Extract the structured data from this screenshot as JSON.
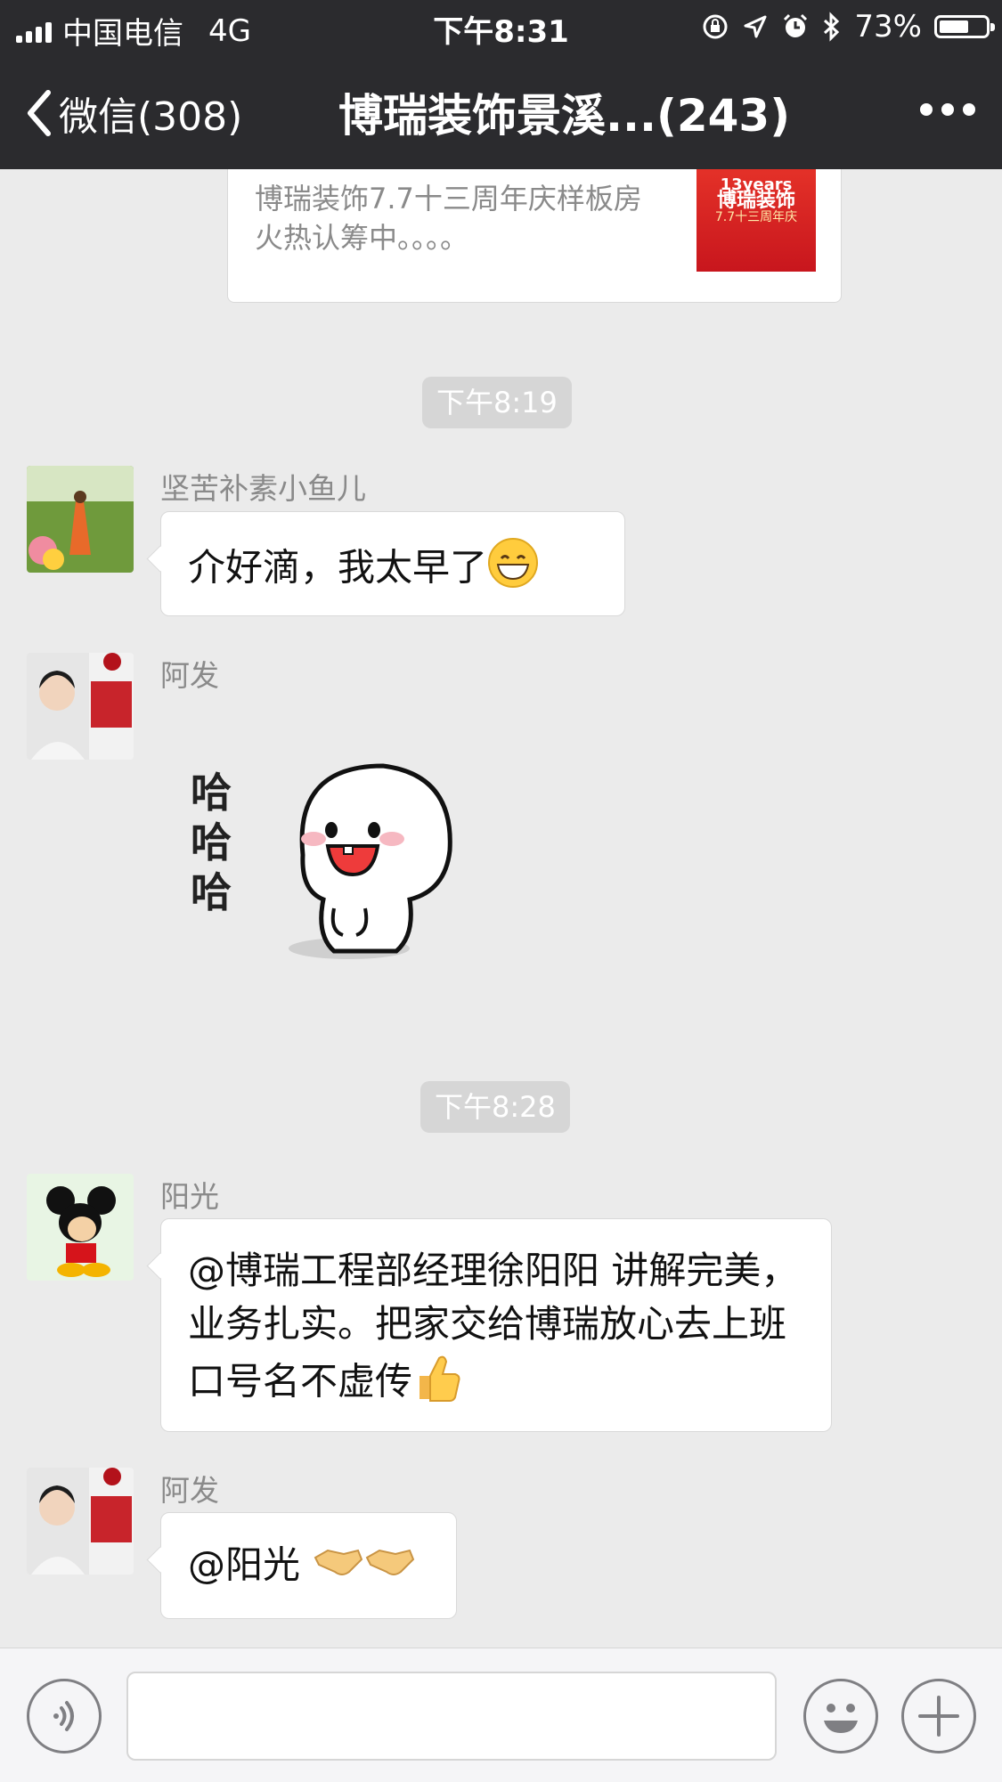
{
  "status_bar": {
    "carrier": "中国电信",
    "network": "4G",
    "time": "下午8:31",
    "battery": "73%",
    "battery_level": 0.73
  },
  "nav": {
    "back_label": "微信(308)",
    "title": "博瑞装饰景溪...(243)"
  },
  "shared_card": {
    "text": "博瑞装饰7.7十三周年庆样板房火热认筹中。。。。",
    "thumb_line1": "13years",
    "thumb_line2": "博瑞装饰",
    "thumb_line3": "7.7十三周年庆"
  },
  "messages": [
    {
      "type": "timestamp",
      "text": "下午8:19"
    },
    {
      "type": "text",
      "sender": "坚苦补素小鱼儿",
      "text": "介好滴，我太早了",
      "emoji": "grin-emoji"
    },
    {
      "type": "sticker",
      "sender": "阿发",
      "sticker_text": "哈哈哈"
    },
    {
      "type": "timestamp",
      "text": "下午8:28"
    },
    {
      "type": "text",
      "sender": "阳光",
      "text": "@博瑞工程部经理徐阳阳 讲解完美，业务扎实。把家交给博瑞放心去上班口号名不虚传",
      "emoji": "thumbs-up-emoji"
    },
    {
      "type": "text",
      "sender": "阿发",
      "text": "@阳光 ",
      "emoji": "handshake-emoji"
    }
  ],
  "input_bar": {
    "voice_icon": "voice-icon",
    "emoji_icon": "smiley-icon",
    "plus_icon": "plus-icon",
    "input_value": ""
  },
  "colors": {
    "nav_bg": "#2b2b2e",
    "chat_bg": "#ebebeb",
    "bubble_bg": "#ffffff",
    "timestamp_bg": "#d6d6d6"
  }
}
